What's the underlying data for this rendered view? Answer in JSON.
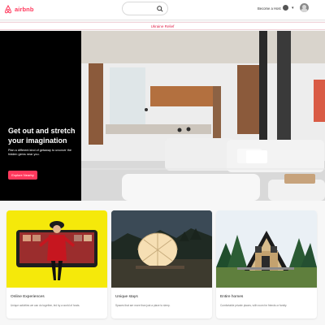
{
  "header": {
    "logo_text": "airbnb",
    "host_link": "Become a Host"
  },
  "banner": {
    "text": "Ukraine Relief"
  },
  "hero": {
    "title": "Get out and stretch your imagination",
    "subtitle": "Plan a different kind of getaway to uncover the hidden gems near you.",
    "cta": "Explore Nearby"
  },
  "cards": [
    {
      "title": "Online Experiences",
      "desc": "Unique activities we can do together, led by a world of hosts."
    },
    {
      "title": "Unique stays",
      "desc": "Spaces that are more than just a place to sleep."
    },
    {
      "title": "Entire homes",
      "desc": "Comfortable private places, with room for friends or family."
    }
  ],
  "colors": {
    "brand": "#ff385c",
    "banner_text": "#e2254c"
  }
}
